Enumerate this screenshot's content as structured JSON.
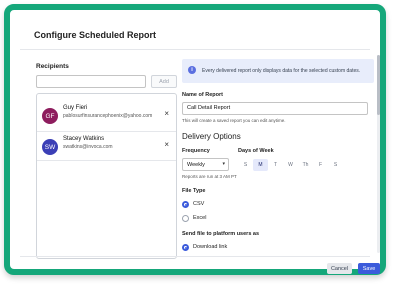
{
  "dialog": {
    "title": "Configure Scheduled Report"
  },
  "recipients": {
    "label": "Recipients",
    "input_value": "",
    "add_label": "Add",
    "items": [
      {
        "initials": "GF",
        "avatar_color": "#8e1d5e",
        "name": "Guy Fieri",
        "email": "pablosurfinsurancephoenix@yahoo.com"
      },
      {
        "initials": "SW",
        "avatar_color": "#3b3fb6",
        "name": "Stacey Watkins",
        "email": "swatkins@invoca.com"
      }
    ],
    "remove_icon": "×"
  },
  "info_banner": {
    "icon": "info-icon",
    "text": "Every delivered report only displays data for the selected custom dates."
  },
  "report": {
    "name_label": "Name of Report",
    "name_value": "Call Detail Report",
    "name_helper": "This will create a saved report you can edit anytime."
  },
  "delivery": {
    "title": "Delivery Options",
    "frequency_label": "Frequency",
    "frequency_value": "Weekly",
    "frequency_helper": "Reports are run at 3 AM PT",
    "days_label": "Days of Week",
    "days": [
      {
        "label": "S",
        "selected": false
      },
      {
        "label": "M",
        "selected": true
      },
      {
        "label": "T",
        "selected": false
      },
      {
        "label": "W",
        "selected": false
      },
      {
        "label": "Th",
        "selected": false
      },
      {
        "label": "F",
        "selected": false
      },
      {
        "label": "S",
        "selected": false
      }
    ]
  },
  "file_type": {
    "label": "File Type",
    "options": [
      {
        "label": "CSV",
        "selected": true
      },
      {
        "label": "Excel",
        "selected": false
      }
    ]
  },
  "send_file": {
    "label": "Send file to platform users as",
    "options": [
      {
        "label": "Download link",
        "selected": true
      }
    ]
  },
  "footer": {
    "cancel_label": "Cancel",
    "save_label": "Save"
  },
  "colors": {
    "frame": "#15a77a",
    "primary": "#3b5bdb",
    "banner_bg": "#e8edfb"
  }
}
